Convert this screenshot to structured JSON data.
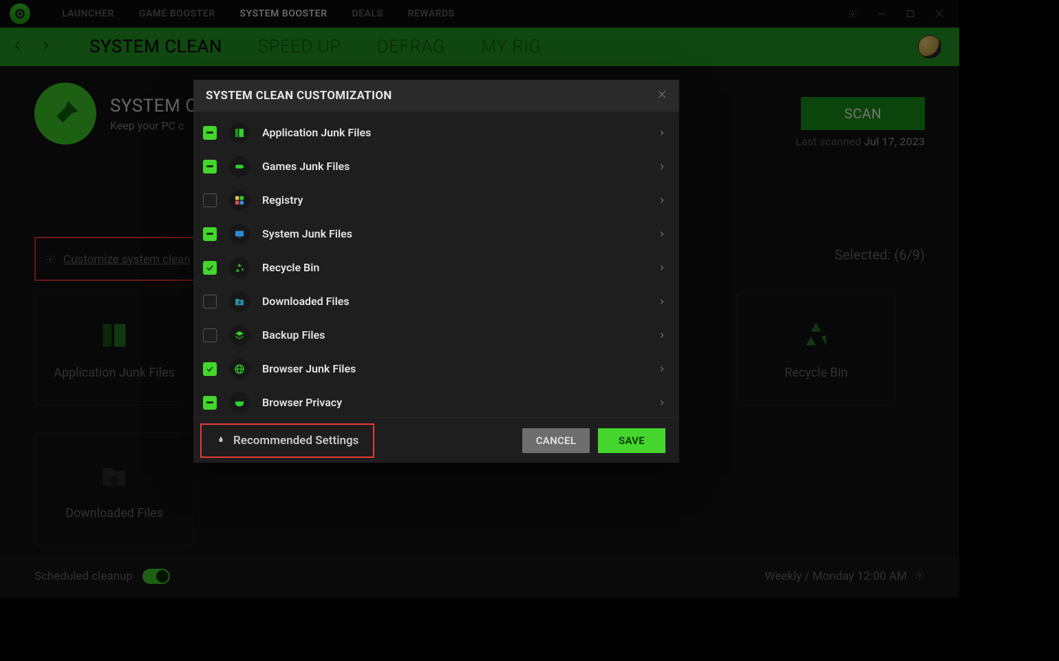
{
  "titlebar": {
    "tabs": [
      "LAUNCHER",
      "GAME BOOSTER",
      "SYSTEM BOOSTER",
      "DEALS",
      "REWARDS"
    ],
    "active": 2
  },
  "subbar": {
    "tabs": [
      "SYSTEM CLEAN",
      "SPEED UP",
      "DEFRAG",
      "MY RIG"
    ],
    "active": 0
  },
  "hero": {
    "title": "SYSTEM C",
    "subtitle": "Keep your PC c",
    "scan": "SCAN",
    "lastscan_label": "Last scanned ",
    "lastscan_value": "Jul 17, 2023"
  },
  "customize": {
    "label": "Customize system clean"
  },
  "selected": {
    "label": "Selected: (6/9)"
  },
  "tiles": {
    "app_junk": "Application Junk Files",
    "recycle": "Recycle Bin",
    "downloaded": "Downloaded Files"
  },
  "bottom": {
    "sched": "Scheduled cleanup",
    "when": "Weekly / Monday 12:00 AM"
  },
  "modal": {
    "title": "SYSTEM CLEAN CUSTOMIZATION",
    "items": [
      {
        "state": "semi",
        "label": "Application Junk Files",
        "icon": "app"
      },
      {
        "state": "semi",
        "label": "Games Junk Files",
        "icon": "game"
      },
      {
        "state": "off",
        "label": "Registry",
        "icon": "reg"
      },
      {
        "state": "semi",
        "label": "System Junk Files",
        "icon": "sys"
      },
      {
        "state": "full",
        "label": "Recycle Bin",
        "icon": "rec"
      },
      {
        "state": "off",
        "label": "Downloaded Files",
        "icon": "dl"
      },
      {
        "state": "off",
        "label": "Backup Files",
        "icon": "bak"
      },
      {
        "state": "full",
        "label": "Browser Junk Files",
        "icon": "web"
      },
      {
        "state": "semi",
        "label": "Browser Privacy",
        "icon": "mask"
      }
    ],
    "recommended": "Recommended Settings",
    "cancel": "CANCEL",
    "save": "SAVE"
  }
}
